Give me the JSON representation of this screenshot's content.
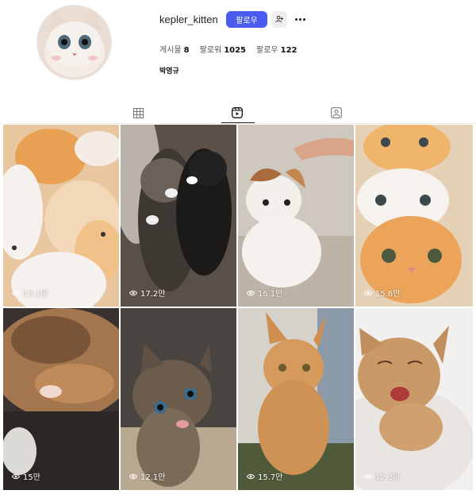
{
  "profile": {
    "username": "kepler_kitten",
    "follow_label": "팔로우",
    "posts_label": "게시물",
    "posts_count": "8",
    "followers_label": "팔로워",
    "followers_count": "1025",
    "following_label": "팔로우",
    "following_count": "122",
    "full_name": "박영규"
  },
  "icons": {
    "avatar": "cat-avatar",
    "suggest": "person-add-icon",
    "more": "more-horizontal-icon",
    "tab_posts": "grid-icon",
    "tab_reels": "reels-icon",
    "tab_tagged": "tagged-icon",
    "views": "eye-icon"
  },
  "tabs": {
    "active": "reels"
  },
  "colors": {
    "accent": "#4a5cf0"
  },
  "reels": [
    {
      "views": "13.1만"
    },
    {
      "views": "17.2만"
    },
    {
      "views": "16.1만"
    },
    {
      "views": "15.6만"
    },
    {
      "views": "15만"
    },
    {
      "views": "12.1만"
    },
    {
      "views": "15.7만"
    },
    {
      "views": "12.3만"
    }
  ]
}
